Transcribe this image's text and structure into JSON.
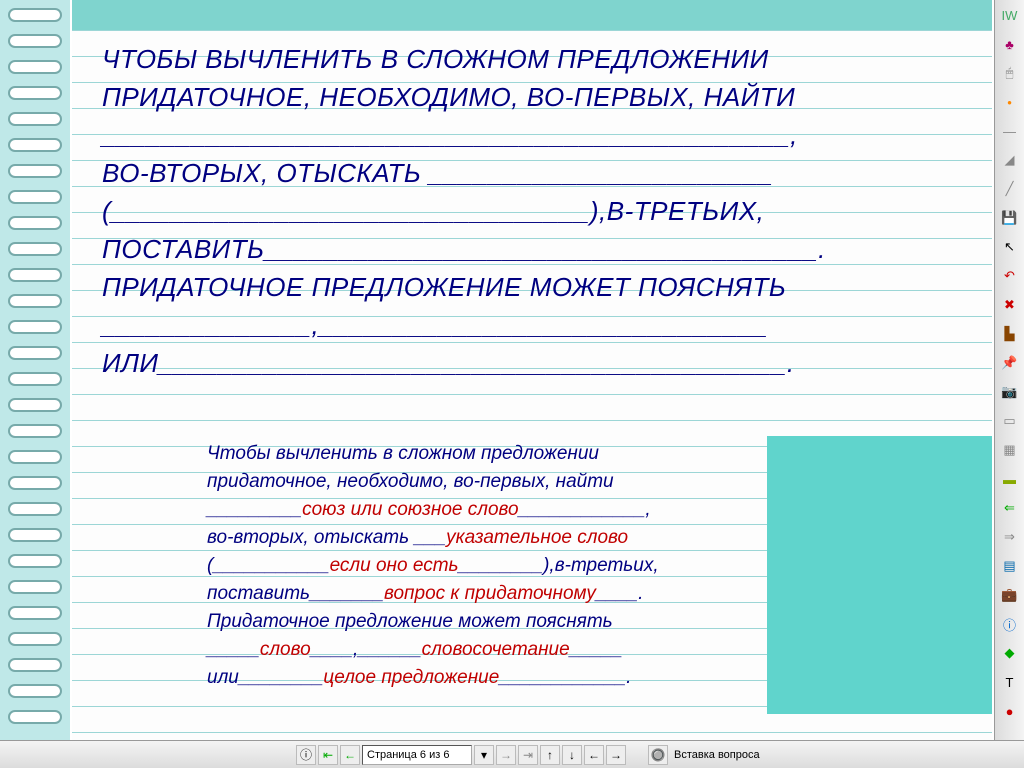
{
  "main_text": {
    "line1": "Чтобы вычленить в сложном предложении",
    "line2": "придаточное, необходимо, во-первых, найти",
    "line3_blank": "______________________________________________,",
    "line4a": "во-вторых, отыскать ",
    "line4_blank": "_______________________",
    "line5_open": "(",
    "line5_blank": "________________________________",
    "line5_close": "),в-третьих,",
    "line6a": "поставить",
    "line6_blank": "_____________________________________.",
    "line7": "Придаточное предложение может пояснять",
    "line8_blank1": "______________",
    "line8_sep": ",",
    "line8_blank2": "______________________________",
    "line9a": "или",
    "line9_blank": "__________________________________________."
  },
  "answer_text": {
    "line1": "Чтобы вычленить в сложном предложении",
    "line2": "придаточное, необходимо, во-первых, найти",
    "fill1": "союз или союзное слово",
    "line4a": "во-вторых, отыскать ",
    "fill2": "указательное слово",
    "fill3": "если оно есть",
    "line5_close": "),в-третьих,",
    "line6a": "поставить",
    "fill4": "вопрос к придаточному",
    "line7": "Придаточное предложение может пояснять",
    "fill5": "слово",
    "fill6": "словосочетание",
    "line9a": "или",
    "fill7": "целое предложение"
  },
  "statusbar": {
    "page_label": "Страница 6 из 6",
    "insert_label": "Вставка вопроса"
  },
  "toolbar_icons": [
    {
      "name": "iw-icon",
      "g": "IW",
      "c": "#4a6"
    },
    {
      "name": "bulb-icon",
      "g": "♣",
      "c": "#a06"
    },
    {
      "name": "mouse-icon",
      "g": "🖱",
      "c": "#888"
    },
    {
      "name": "dot-icon",
      "g": "•",
      "c": "#f80"
    },
    {
      "name": "line-icon",
      "g": "—",
      "c": "#888"
    },
    {
      "name": "shape-icon",
      "g": "◢",
      "c": "#888"
    },
    {
      "name": "slash-icon",
      "g": "╱",
      "c": "#888"
    },
    {
      "name": "floppy-icon",
      "g": "💾",
      "c": "#c08"
    },
    {
      "name": "pointer-icon",
      "g": "↖",
      "c": "#000"
    },
    {
      "name": "undo-icon",
      "g": "↶",
      "c": "#c00"
    },
    {
      "name": "delete-icon",
      "g": "✖",
      "c": "#c00"
    },
    {
      "name": "stamp-icon",
      "g": "▙",
      "c": "#840"
    },
    {
      "name": "pin-icon",
      "g": "📌",
      "c": "#06c"
    },
    {
      "name": "camera-icon",
      "g": "📷",
      "c": "#880"
    },
    {
      "name": "box-icon",
      "g": "▭",
      "c": "#888"
    },
    {
      "name": "grid-icon",
      "g": "▦",
      "c": "#888"
    },
    {
      "name": "rect-icon",
      "g": "▬",
      "c": "#8a0"
    },
    {
      "name": "left-icon",
      "g": "⇐",
      "c": "#0a0"
    },
    {
      "name": "right-icon",
      "g": "⇒",
      "c": "#888"
    },
    {
      "name": "table-icon",
      "g": "▤",
      "c": "#06a"
    },
    {
      "name": "case-icon",
      "g": "💼",
      "c": "#a00"
    },
    {
      "name": "info-icon",
      "g": "ⓘ",
      "c": "#06c"
    },
    {
      "name": "greenbox-icon",
      "g": "◆",
      "c": "#0a0"
    },
    {
      "name": "tag-icon",
      "g": "T",
      "c": "#000"
    },
    {
      "name": "reddot-icon",
      "g": "●",
      "c": "#c00"
    }
  ]
}
